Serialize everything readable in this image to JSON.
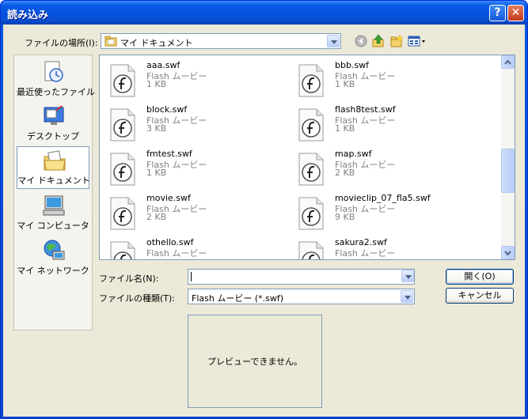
{
  "window": {
    "title": "読み込み",
    "help": "?",
    "close": "✕"
  },
  "lookin": {
    "label": "ファイルの場所(I):",
    "value": "マイ ドキュメント"
  },
  "places": [
    {
      "label": "最近使ったファイル",
      "icon": "recent-documents-icon"
    },
    {
      "label": "デスクトップ",
      "icon": "desktop-icon"
    },
    {
      "label": "マイ ドキュメント",
      "icon": "my-documents-icon"
    },
    {
      "label": "マイ コンピュータ",
      "icon": "my-computer-icon"
    },
    {
      "label": "マイ ネットワーク",
      "icon": "my-network-icon"
    }
  ],
  "files": [
    {
      "name": "aaa.swf",
      "type": "Flash ムービー",
      "size": "1 KB"
    },
    {
      "name": "bbb.swf",
      "type": "Flash ムービー",
      "size": "1 KB"
    },
    {
      "name": "block.swf",
      "type": "Flash ムービー",
      "size": "3 KB"
    },
    {
      "name": "flash8test.swf",
      "type": "Flash ムービー",
      "size": "1 KB"
    },
    {
      "name": "fmtest.swf",
      "type": "Flash ムービー",
      "size": "1 KB"
    },
    {
      "name": "map.swf",
      "type": "Flash ムービー",
      "size": "2 KB"
    },
    {
      "name": "movie.swf",
      "type": "Flash ムービー",
      "size": "2 KB"
    },
    {
      "name": "movieclip_07_fla5.swf",
      "type": "Flash ムービー",
      "size": "9 KB"
    },
    {
      "name": "othello.swf",
      "type": "Flash ムービー",
      "size": ""
    },
    {
      "name": "sakura2.swf",
      "type": "Flash ムービー",
      "size": ""
    }
  ],
  "filename": {
    "label": "ファイル名(N):",
    "value": ""
  },
  "filetype": {
    "label": "ファイルの種類(T):",
    "value": "Flash ムービー (*.swf)"
  },
  "buttons": {
    "open": "開く(O)",
    "cancel": "キャンセル"
  },
  "preview": {
    "text": "プレビューできません。"
  }
}
